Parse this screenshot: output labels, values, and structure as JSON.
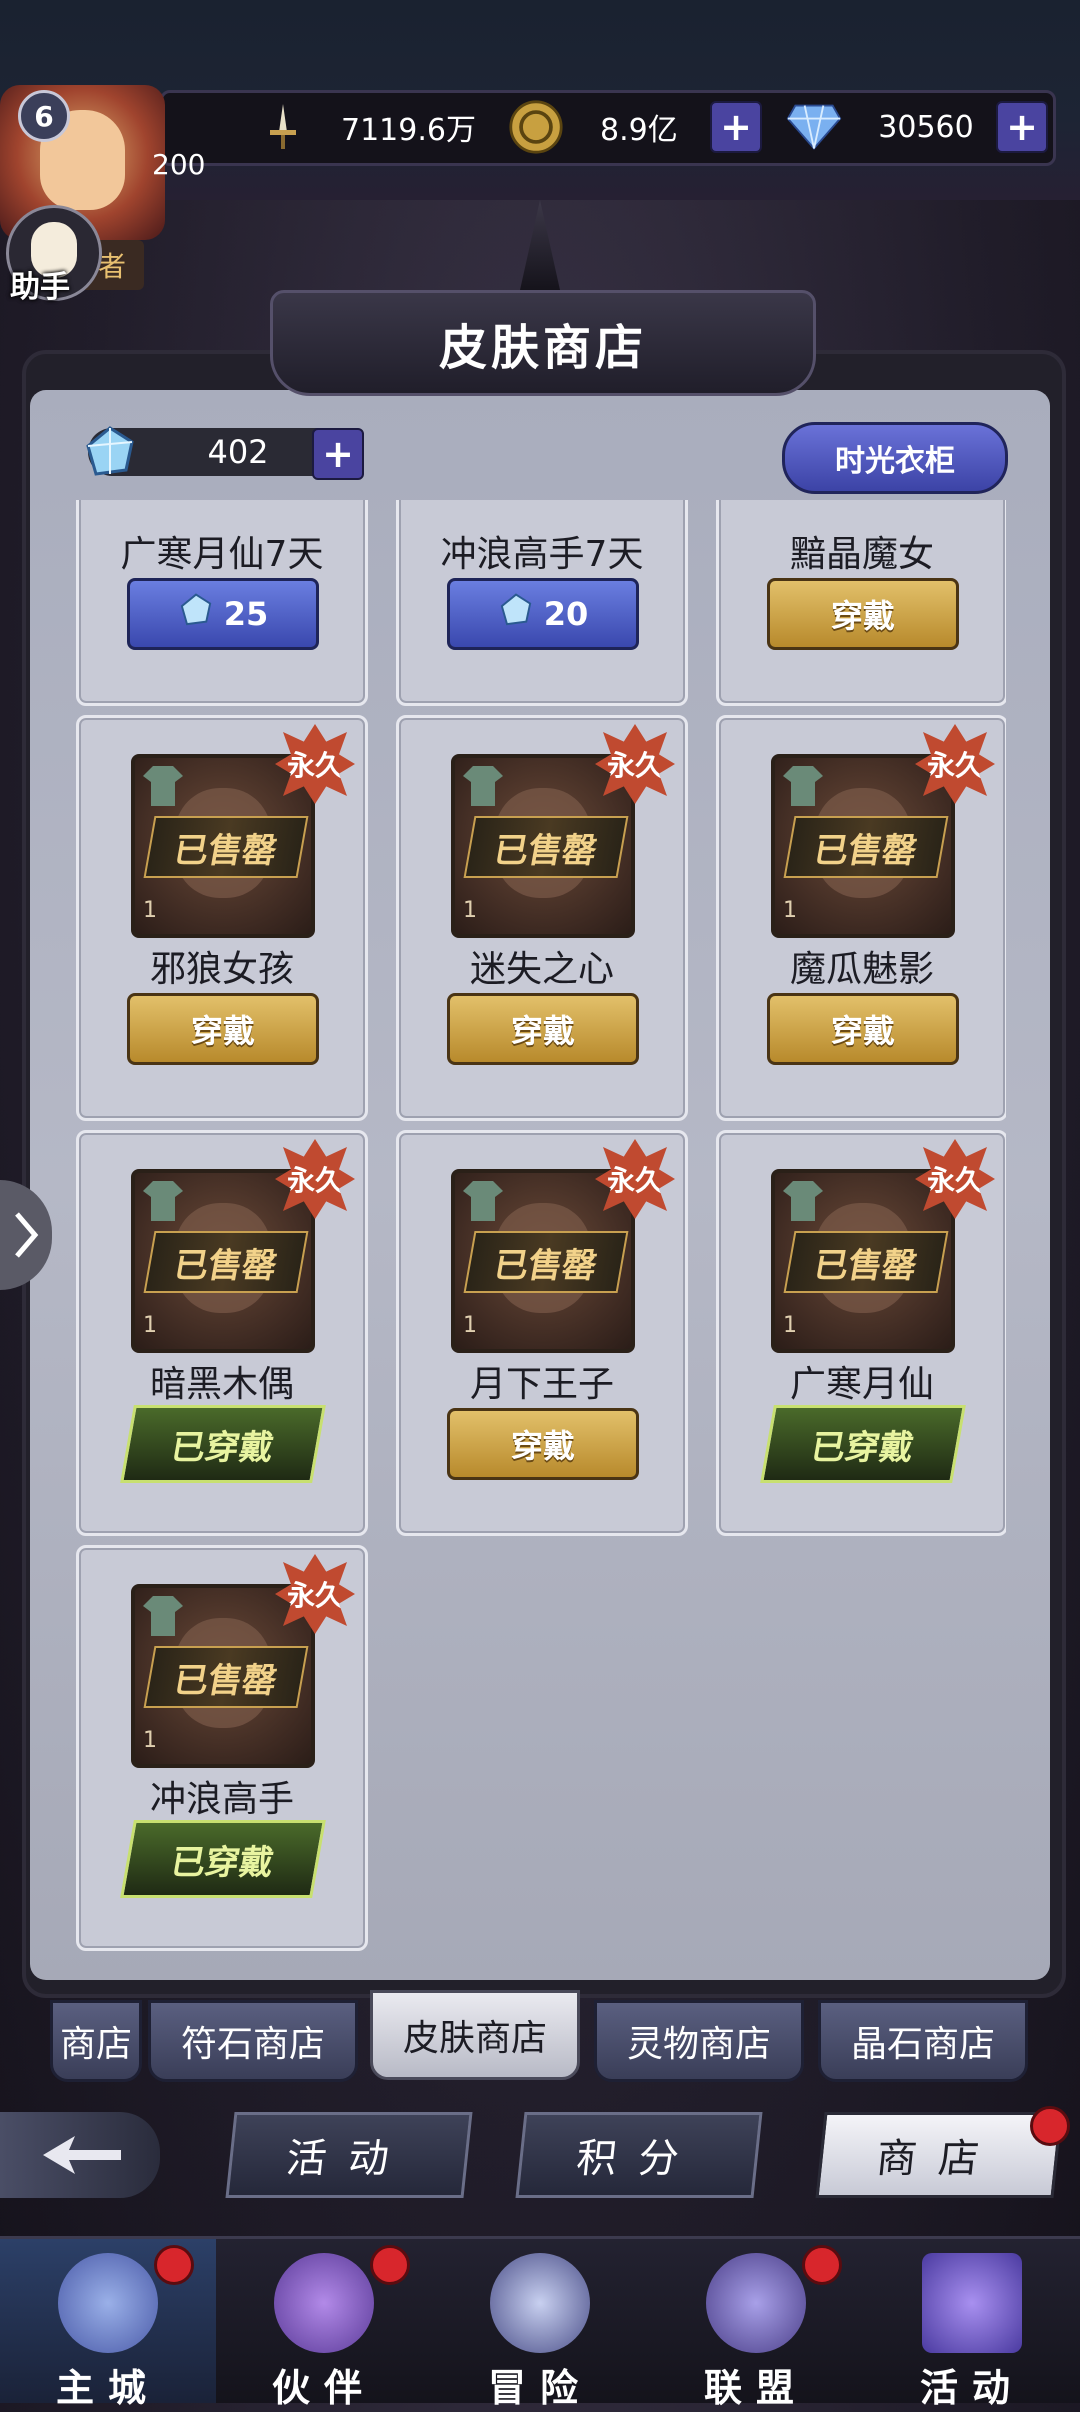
{
  "header": {
    "level": "6",
    "vip_value": "200",
    "assistant_label": "助手",
    "title_tag": "者",
    "power": "7119.6万",
    "gold": "8.9亿",
    "diamonds": "30560"
  },
  "shop": {
    "title": "皮肤商店",
    "crystal_count": "402",
    "wardrobe_label": "时光衣柜"
  },
  "top_row": [
    {
      "name": "广寒月仙7天",
      "kind": "price",
      "price": "25"
    },
    {
      "name": "冲浪高手7天",
      "kind": "price",
      "price": "20"
    },
    {
      "name": "黯晶魔女",
      "kind": "wear",
      "button": "穿戴"
    }
  ],
  "skins": [
    {
      "name": "邪狼女孩",
      "badge": "永久",
      "sold": "已售罄",
      "qty": "1",
      "button": "穿戴",
      "state": "wear"
    },
    {
      "name": "迷失之心",
      "badge": "永久",
      "sold": "已售罄",
      "qty": "1",
      "button": "穿戴",
      "state": "wear"
    },
    {
      "name": "魔瓜魅影",
      "badge": "永久",
      "sold": "已售罄",
      "qty": "1",
      "button": "穿戴",
      "state": "wear"
    },
    {
      "name": "暗黑木偶",
      "badge": "永久",
      "sold": "已售罄",
      "qty": "1",
      "button": "已穿戴",
      "state": "worn"
    },
    {
      "name": "月下王子",
      "badge": "永久",
      "sold": "已售罄",
      "qty": "1",
      "button": "穿戴",
      "state": "wear"
    },
    {
      "name": "广寒月仙",
      "badge": "永久",
      "sold": "已售罄",
      "qty": "1",
      "button": "已穿戴",
      "state": "worn"
    },
    {
      "name": "冲浪高手",
      "badge": "永久",
      "sold": "已售罄",
      "qty": "1",
      "button": "已穿戴",
      "state": "worn"
    }
  ],
  "subtabs": [
    "商店",
    "符石商店",
    "皮肤商店",
    "灵物商店",
    "晶石商店"
  ],
  "activity_row": [
    "活动",
    "积分",
    "商店"
  ],
  "bottom_nav": [
    "主城",
    "伙伴",
    "冒险",
    "联盟",
    "活动"
  ],
  "colors": {
    "gold_button": "#c9a044",
    "worn_button": "#3c5a22",
    "price_button": "#4a58c0",
    "permanent_badge": "#c04a30",
    "red_dot": "#d8262c"
  }
}
